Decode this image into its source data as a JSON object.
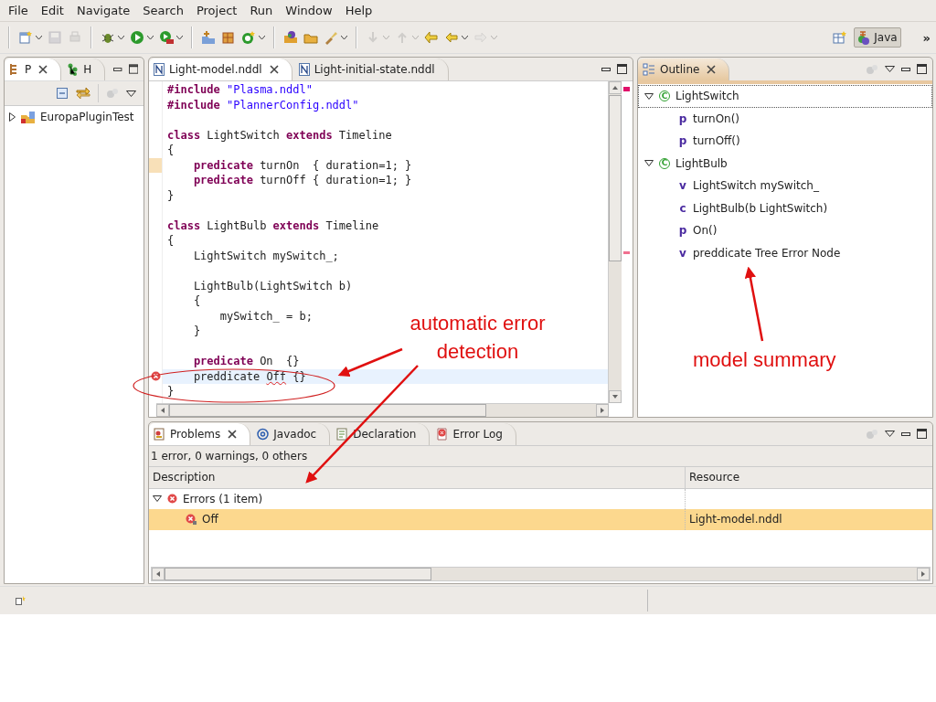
{
  "menu": [
    "File",
    "Edit",
    "Navigate",
    "Search",
    "Project",
    "Run",
    "Window",
    "Help"
  ],
  "toolbar": [
    {
      "items": [
        {
          "disabled": false,
          "dropdown": true
        },
        {
          "disabled": true,
          "dropdown": false
        },
        {
          "disabled": true,
          "dropdown": false
        }
      ]
    },
    {
      "items": [
        {
          "disabled": false,
          "dropdown": true
        },
        {
          "disabled": false,
          "dropdown": true
        },
        {
          "disabled": false,
          "dropdown": true
        }
      ]
    },
    {
      "items": [
        {
          "disabled": false,
          "dropdown": false
        },
        {
          "disabled": false,
          "dropdown": false
        },
        {
          "disabled": false,
          "dropdown": true
        }
      ]
    },
    {
      "items": [
        {
          "disabled": false,
          "dropdown": false
        },
        {
          "disabled": false,
          "dropdown": false
        },
        {
          "disabled": false,
          "dropdown": true
        }
      ]
    },
    {
      "items": [
        {
          "disabled": true,
          "dropdown": true
        },
        {
          "disabled": true,
          "dropdown": true
        },
        {
          "disabled": false,
          "dropdown": false
        },
        {
          "disabled": false,
          "dropdown": true
        },
        {
          "disabled": true,
          "dropdown": true
        }
      ]
    }
  ],
  "perspective": {
    "label": "Java",
    "selected": true,
    "more": "»"
  },
  "left_panel": {
    "tabs": [
      {
        "label": "P",
        "selected": true
      },
      {
        "label": "H",
        "selected": false
      }
    ],
    "tree": [
      {
        "label": "EuropaPluginTest",
        "expanded": false
      }
    ]
  },
  "editor": {
    "tabs": [
      {
        "label": "Light-model.nddl",
        "selected": true
      },
      {
        "label": "Light-initial-state.nddl",
        "selected": false
      }
    ],
    "lines": [
      {
        "kind": "code",
        "tokens": [
          {
            "kind": "kw",
            "text": "#include"
          },
          {
            "kind": "str",
            "text": " \"Plasma.nddl\""
          }
        ]
      },
      {
        "kind": "code",
        "tokens": [
          {
            "kind": "kw",
            "text": "#include"
          },
          {
            "kind": "str",
            "text": " \"PlannerConfig.nddl\""
          }
        ]
      },
      {
        "kind": "blank"
      },
      {
        "kind": "code",
        "tokens": [
          {
            "kind": "kw",
            "text": "class"
          },
          {
            "kind": "plain",
            "text": " LightSwitch "
          },
          {
            "kind": "kw",
            "text": "extends"
          },
          {
            "kind": "plain",
            "text": " Timeline"
          }
        ]
      },
      {
        "kind": "code",
        "tokens": [
          {
            "kind": "plain",
            "text": "{"
          }
        ]
      },
      {
        "kind": "changed",
        "tokens": [
          {
            "kind": "kw",
            "text": "    predicate"
          },
          {
            "kind": "plain",
            "text": " turnOn  { duration=1; }"
          }
        ]
      },
      {
        "kind": "code",
        "tokens": [
          {
            "kind": "kw",
            "text": "    predicate"
          },
          {
            "kind": "plain",
            "text": " turnOff { duration=1; }"
          }
        ]
      },
      {
        "kind": "code",
        "tokens": [
          {
            "kind": "plain",
            "text": "}"
          }
        ]
      },
      {
        "kind": "blank"
      },
      {
        "kind": "code",
        "tokens": [
          {
            "kind": "kw",
            "text": "class"
          },
          {
            "kind": "plain",
            "text": " LightBulb "
          },
          {
            "kind": "kw",
            "text": "extends"
          },
          {
            "kind": "plain",
            "text": " Timeline"
          }
        ]
      },
      {
        "kind": "code",
        "tokens": [
          {
            "kind": "plain",
            "text": "{"
          }
        ]
      },
      {
        "kind": "code",
        "tokens": [
          {
            "kind": "plain",
            "text": "    LightSwitch mySwitch_;"
          }
        ]
      },
      {
        "kind": "blank"
      },
      {
        "kind": "code",
        "tokens": [
          {
            "kind": "plain",
            "text": "    LightBulb(LightSwitch b)"
          }
        ]
      },
      {
        "kind": "code",
        "tokens": [
          {
            "kind": "plain",
            "text": "    {"
          }
        ]
      },
      {
        "kind": "code",
        "tokens": [
          {
            "kind": "plain",
            "text": "        mySwitch_ = b;"
          }
        ]
      },
      {
        "kind": "code",
        "tokens": [
          {
            "kind": "plain",
            "text": "    }"
          }
        ]
      },
      {
        "kind": "blank"
      },
      {
        "kind": "code",
        "tokens": [
          {
            "kind": "kw",
            "text": "    predicate"
          },
          {
            "kind": "plain",
            "text": " On  {}"
          }
        ]
      },
      {
        "kind": "error",
        "tokens": [
          {
            "kind": "plain",
            "text": "    preddicate "
          },
          {
            "kind": "squiggle",
            "text": "Off"
          },
          {
            "kind": "plain",
            "text": " {}"
          }
        ]
      },
      {
        "kind": "code",
        "tokens": [
          {
            "kind": "plain",
            "text": "}"
          }
        ]
      }
    ]
  },
  "outline": {
    "tab": {
      "label": "Outline"
    },
    "tree": [
      {
        "badge": "C",
        "label": "LightSwitch",
        "expanded": true,
        "selected": true,
        "children": [
          {
            "badge": "p",
            "label": "turnOn()"
          },
          {
            "badge": "p",
            "label": "turnOff()"
          }
        ]
      },
      {
        "badge": "C",
        "label": "LightBulb",
        "expanded": true,
        "selected": false,
        "children": [
          {
            "badge": "v",
            "label": "LightSwitch mySwitch_"
          },
          {
            "badge": "c",
            "label": "LightBulb(b LightSwitch)"
          },
          {
            "badge": "p",
            "label": "On()"
          },
          {
            "badge": "v",
            "label": "preddicate Tree Error Node"
          }
        ]
      }
    ]
  },
  "problems": {
    "tabs": [
      {
        "label": "Problems",
        "selected": true
      },
      {
        "label": "Javadoc",
        "selected": false
      },
      {
        "label": "Declaration",
        "selected": false
      },
      {
        "label": "Error Log",
        "selected": false
      }
    ],
    "summary": "1 error, 0 warnings, 0 others",
    "columns": [
      "Description",
      "Resource"
    ],
    "rows": [
      {
        "description": "Errors (1 item)",
        "expanded": true,
        "children": [
          {
            "description": "Off",
            "resource": "Light-model.nddl",
            "selected": true
          }
        ]
      }
    ]
  },
  "annotations": [
    {
      "text": "automatic error detection"
    },
    {
      "text": "model summary"
    }
  ]
}
